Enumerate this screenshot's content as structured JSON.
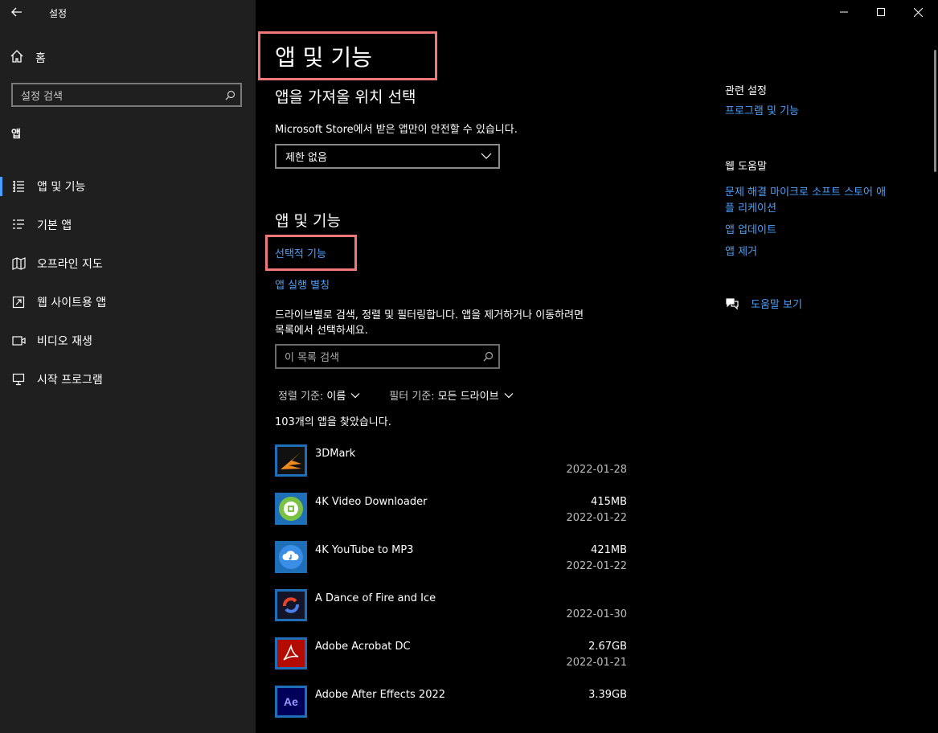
{
  "window": {
    "title": "설정",
    "back_icon": "back-arrow-icon",
    "controls": [
      "minimize-icon",
      "maximize-icon",
      "close-icon"
    ]
  },
  "sidebar": {
    "home_label": "홈",
    "search_placeholder": "설정 검색",
    "section_label": "앱",
    "items": [
      {
        "label": "앱 및 기능",
        "icon": "apps-list-icon",
        "active": true
      },
      {
        "label": "기본 앱",
        "icon": "default-apps-icon",
        "active": false
      },
      {
        "label": "오프라인 지도",
        "icon": "map-icon",
        "active": false
      },
      {
        "label": "웹 사이트용 앱",
        "icon": "website-apps-icon",
        "active": false
      },
      {
        "label": "비디오 재생",
        "icon": "video-icon",
        "active": false
      },
      {
        "label": "시작 프로그램",
        "icon": "startup-icon",
        "active": false
      }
    ]
  },
  "main": {
    "page_title": "앱 및 기능",
    "source_heading": "앱을 가져올 위치 선택",
    "source_description": "Microsoft Store에서 받은 앱만이 안전할 수 있습니다.",
    "source_dropdown_value": "제한 없음",
    "apps_heading": "앱 및 기능",
    "optional_features_link": "선택적 기능",
    "aliases_link": "앱 실행 별칭",
    "list_description_line1": "드라이브별로 검색, 정렬 및 필터링합니다. 앱을 제거하거나 이동하려면",
    "list_description_line2": "목록에서 선택하세요.",
    "list_search_placeholder": "이 목록 검색",
    "sort_key": "정렬 기준:",
    "sort_value": "이름",
    "filter_key": "필터 기준:",
    "filter_value": "모든 드라이브",
    "found_count": "103개의 앱을 찾았습니다.",
    "apps": [
      {
        "name": "3DMark",
        "size": "",
        "date": "2022-01-28",
        "icon": "3dmark-icon"
      },
      {
        "name": "4K Video Downloader",
        "size": "415MB",
        "date": "2022-01-22",
        "icon": "4k-video-downloader-icon"
      },
      {
        "name": "4K YouTube to MP3",
        "size": "421MB",
        "date": "2022-01-22",
        "icon": "4k-youtube-mp3-icon"
      },
      {
        "name": "A Dance of Fire and Ice",
        "size": "",
        "date": "2022-01-30",
        "icon": "dance-fire-ice-icon"
      },
      {
        "name": "Adobe Acrobat DC",
        "size": "2.67GB",
        "date": "2022-01-21",
        "icon": "acrobat-icon"
      },
      {
        "name": "Adobe After Effects 2022",
        "size": "3.39GB",
        "date": "",
        "icon": "after-effects-icon"
      }
    ]
  },
  "related": {
    "heading": "관련 설정",
    "programs_link": "프로그램 및 기능",
    "web_help_heading": "웹 도움말",
    "help_link1_line1": "문제 해결 마이크로 소프트 스토어 애",
    "help_link1_line2": "플 리케이션",
    "help_link2": "앱 업데이트",
    "help_link3": "앱 제거",
    "get_help": "도움말 보기"
  },
  "colors": {
    "accent": "#4aa0ff",
    "highlight_box": "#f07878",
    "sidebar_bg": "#1f1f1f",
    "main_bg": "#000000"
  }
}
